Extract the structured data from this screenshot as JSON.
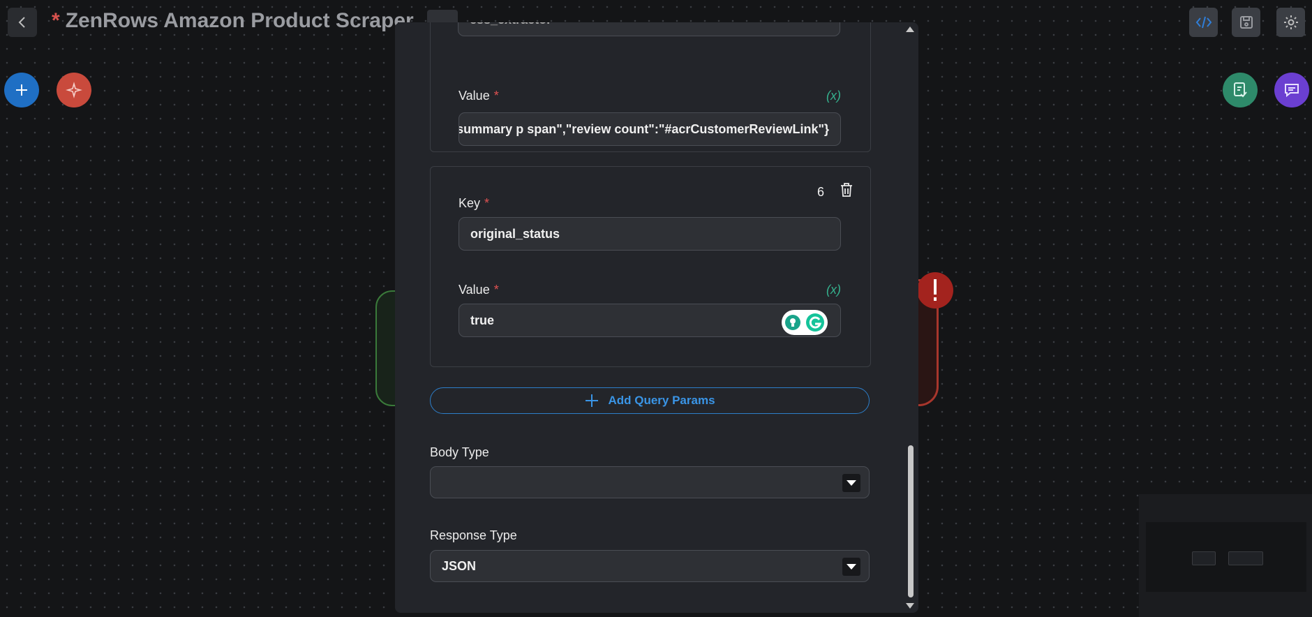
{
  "header": {
    "title": "ZenRows Amazon Product Scraper",
    "unsaved_marker": "*"
  },
  "colors": {
    "accent_blue": "#1f6fc4",
    "accent_red": "#c94a3c",
    "accent_green": "#35b08d",
    "accent_purple": "#6b3fd1",
    "required": "#e05252"
  },
  "icons": {
    "back": "chevron-left-icon",
    "code": "code-icon",
    "save": "floppy-disk-icon",
    "settings": "gear-icon",
    "add": "plus-icon",
    "ai": "sparkles-icon",
    "notes": "checklist-icon",
    "chat": "chat-bubble-icon",
    "delete": "trash-icon"
  },
  "form": {
    "top_field_value": "css_extractor",
    "param5": {
      "value_label": "Value",
      "value": "ct-summary p span\",\"review count\":\"#acrCustomerReviewLink\"}",
      "variable_hint": "(x)"
    },
    "param6": {
      "index": "6",
      "key_label": "Key",
      "key_value": "original_status",
      "value_label": "Value",
      "value": "true",
      "variable_hint": "(x)"
    },
    "add_query_params_label": "Add Query Params",
    "body_type": {
      "label": "Body Type",
      "selected": ""
    },
    "response_type": {
      "label": "Response Type",
      "selected": "JSON"
    }
  }
}
